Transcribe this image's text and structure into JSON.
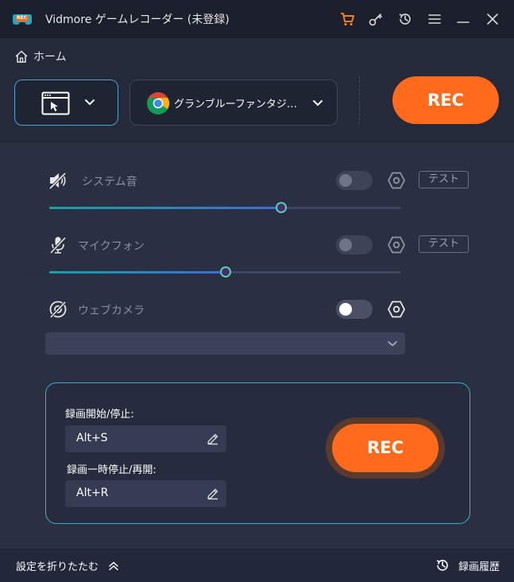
{
  "titlebar": {
    "title": "Vidmore ゲームレコーダー (未登録)",
    "logo_text": "REC",
    "icons": [
      "cart-icon",
      "key-icon",
      "history-icon",
      "menu-icon",
      "minimize-icon",
      "close-icon"
    ],
    "cart_color": "#ff7a1a"
  },
  "breadcrumb": {
    "label": "ホーム"
  },
  "source": {
    "mode_icon": "window-cursor-icon",
    "selected_window": "グランブルーファンタジ…"
  },
  "rec_top": {
    "label": "REC",
    "color": "#ff6b1a"
  },
  "audio": {
    "system": {
      "label": "システム音",
      "enabled": false,
      "test_label": "テスト",
      "volume": 0.66
    },
    "mic": {
      "label": "マイクフォン",
      "enabled": false,
      "test_label": "テスト",
      "volume": 0.5
    }
  },
  "webcam": {
    "label": "ウェブカメラ",
    "enabled": false,
    "selected": ""
  },
  "hotkeys": {
    "start_stop_label": "録画開始/停止:",
    "start_stop_value": "Alt+S",
    "pause_resume_label": "録画一時停止/再開:",
    "pause_resume_value": "Alt+R"
  },
  "rec_bottom": {
    "label": "REC"
  },
  "footer": {
    "collapse_label": "設定を折りたたむ",
    "history_label": "録画履歴"
  },
  "colors": {
    "accent": "#ff6b1a",
    "panel_border": "#2fb4d2",
    "slider_start": "#16a3a3",
    "slider_end": "#3d6bd6"
  }
}
